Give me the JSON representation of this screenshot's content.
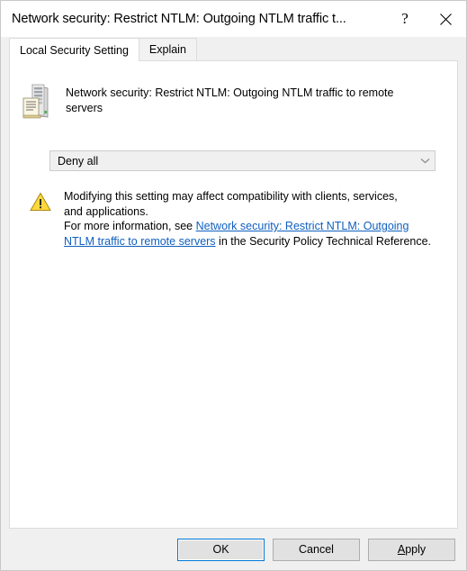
{
  "window": {
    "title": "Network security: Restrict NTLM: Outgoing NTLM traffic t...",
    "help_button": "?",
    "close_button": "✕"
  },
  "tabs": [
    {
      "label": "Local Security Setting",
      "active": true
    },
    {
      "label": "Explain",
      "active": false
    }
  ],
  "setting": {
    "icon": "server-policy-icon",
    "title": "Network security: Restrict NTLM: Outgoing NTLM traffic to remote servers"
  },
  "dropdown": {
    "name": "outgoing-ntlm-traffic-select",
    "value": "Deny all",
    "arrow": "chevron-down-icon"
  },
  "warning": {
    "icon": "warning-triangle-icon",
    "line1": "Modifying this setting may affect compatibility with clients, services,",
    "line2": "and applications.",
    "intro": "For more information, see ",
    "link_text": "Network security: Restrict NTLM: Outgoing NTLM traffic to remote servers",
    "outro": " in the Security Policy Technical Reference."
  },
  "footer": {
    "ok_label": "OK",
    "cancel_label": "Cancel",
    "apply_accel": "A",
    "apply_rest": "pply"
  },
  "colors": {
    "dialog_bg": "#f0f0f0",
    "panel_bg": "#ffffff",
    "titlebar_bg": "#ffffff",
    "link": "#0f5fbf",
    "focus_border": "#0078d7",
    "button_face": "#e1e1e1",
    "warning_yellow": "#ffd83b"
  }
}
